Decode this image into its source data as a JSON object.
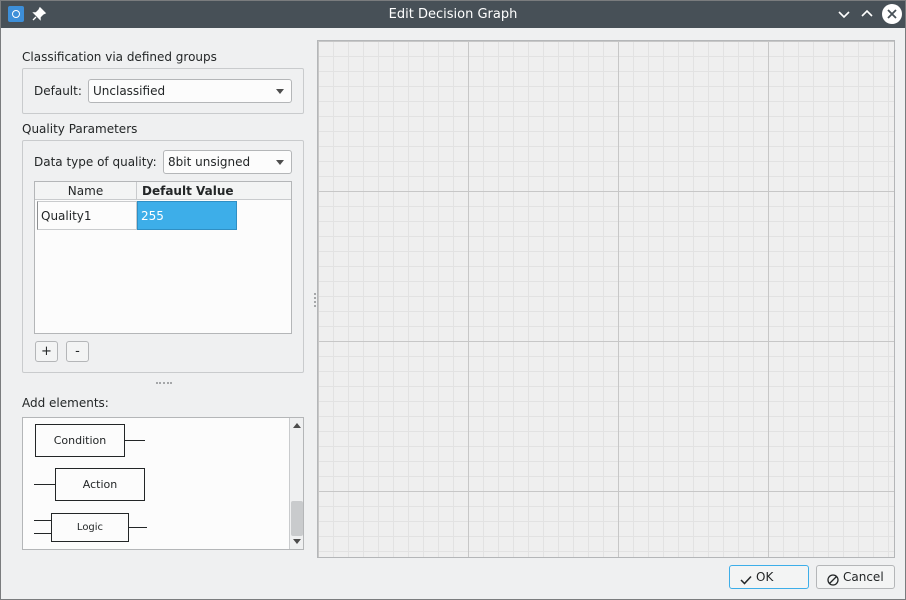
{
  "window": {
    "title": "Edit Decision Graph"
  },
  "classification": {
    "group_title": "Classification via defined groups",
    "default_label": "Default:",
    "default_value": "Unclassified"
  },
  "quality": {
    "group_title": "Quality Parameters",
    "datatype_label": "Data type of quality:",
    "datatype_value": "8bit unsigned",
    "table": {
      "headers": [
        "Name",
        "Default Value"
      ],
      "rows": [
        {
          "name": "Quality1",
          "default_value": "255"
        }
      ]
    },
    "add_label": "+",
    "remove_label": "-"
  },
  "elements": {
    "title": "Add elements:",
    "items": [
      "Condition",
      "Action",
      "Logic"
    ]
  },
  "buttons": {
    "ok": "OK",
    "cancel": "Cancel"
  },
  "colors": {
    "titlebar": "#475057",
    "selection": "#3daee9",
    "canvas_bg": "#efefef"
  },
  "icons": {
    "app": "app-icon",
    "pin": "pin-icon",
    "minimize": "chevron-down-icon",
    "maximize": "chevron-up-icon",
    "close": "close-icon",
    "ok": "check-icon",
    "cancel": "cancel-icon"
  }
}
